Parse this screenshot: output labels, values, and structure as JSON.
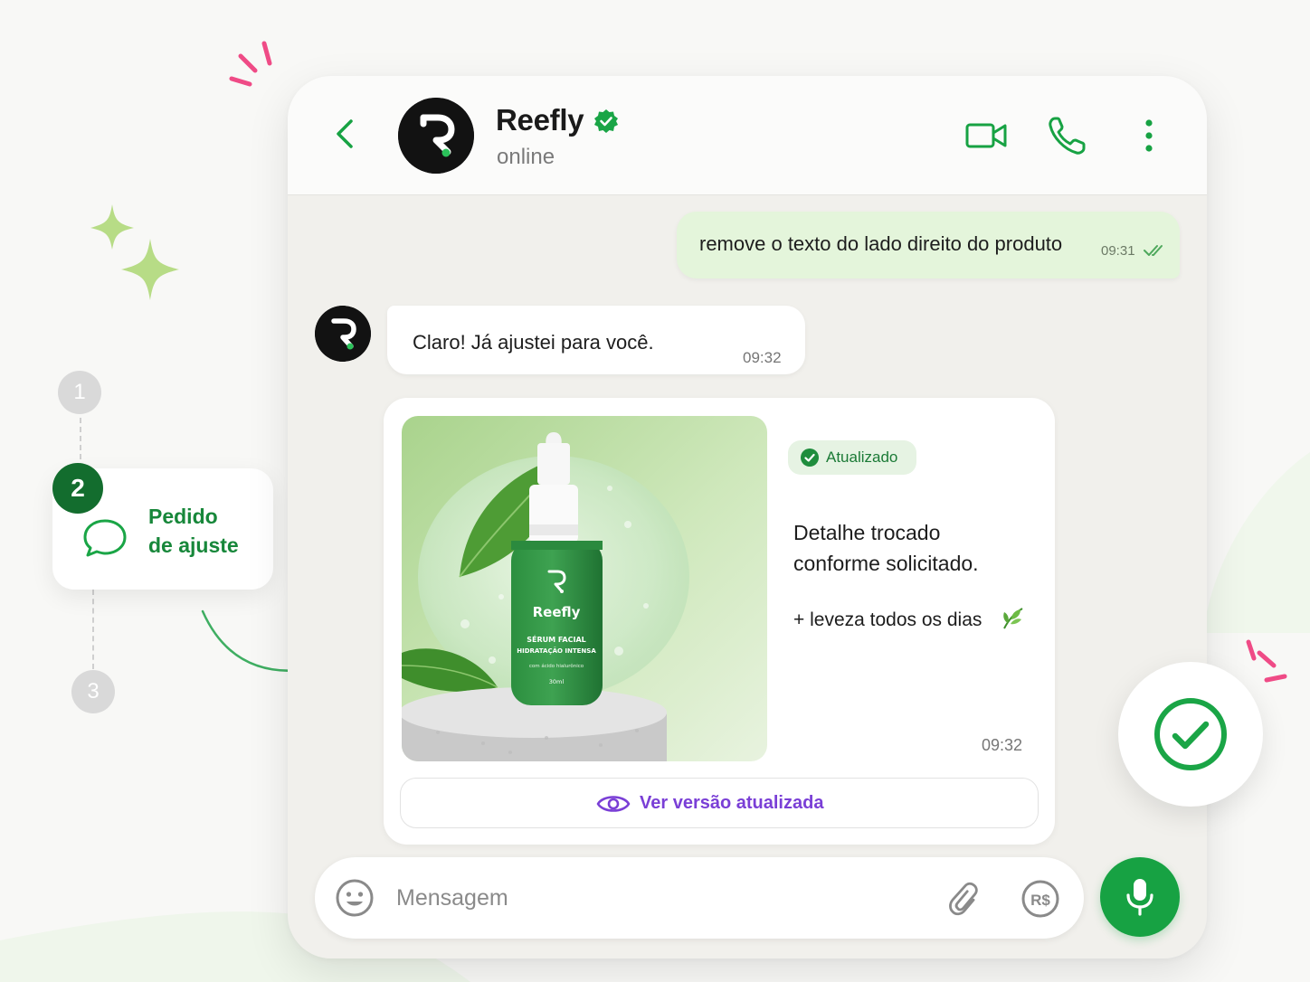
{
  "colors": {
    "brand_green": "#17a243",
    "dark_green": "#136d2e",
    "outgoing_bubble": "#e4f5db",
    "link_purple": "#7a3fd6",
    "accent_pink": "#ef4b86"
  },
  "header": {
    "contact_name": "Reefly",
    "status": "online",
    "icons": [
      "back-arrow-icon",
      "verified-badge-icon",
      "video-call-icon",
      "phone-icon",
      "more-vertical-icon"
    ]
  },
  "messages": {
    "outgoing": {
      "text": "remove o texto do lado direito do produto",
      "time": "09:31"
    },
    "incoming": {
      "text": "Claro! Já ajustei para você.",
      "time": "09:32"
    },
    "card": {
      "badge": "Atualizado",
      "line1": "Detalhe trocado",
      "line2": "conforme solicitado.",
      "tagline": "+ leveza todos os dias",
      "time": "09:32",
      "button_label": "Ver versão atualizada",
      "product": {
        "brand": "Reefly",
        "line1": "SÉRUM FACIAL",
        "line2": "HIDRATAÇÃO INTENSA",
        "line3": "com ácido hialurônico",
        "volume": "30ml"
      }
    }
  },
  "composer": {
    "placeholder": "Mensagem",
    "currency_icon_text": "R$"
  },
  "steps": {
    "step1": "1",
    "step2": "2",
    "step3": "3",
    "active_label_line1": "Pedido",
    "active_label_line2": "de ajuste"
  }
}
